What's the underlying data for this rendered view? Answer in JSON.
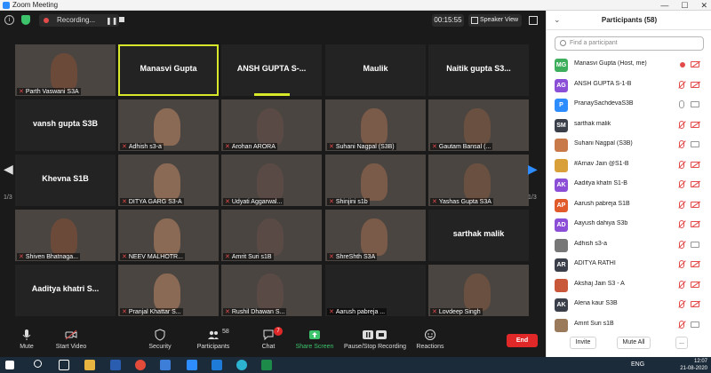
{
  "window": {
    "title": "Zoom Meeting",
    "minimize": "—",
    "maximize": "☐",
    "close": "✕"
  },
  "topbar": {
    "recording_label": "Recording...",
    "pause_symbol": "❚❚",
    "timer": "00:15:55",
    "speaker_view_label": "Speaker View",
    "info_symbol": "i"
  },
  "nav": {
    "left_arrow": "◀",
    "right_arrow": "▶",
    "page_left": "1/3",
    "page_right": "1/3"
  },
  "tiles": [
    {
      "name": "Parth Vaswani S3A",
      "video": true,
      "display": ""
    },
    {
      "name": "Manasvi Gupta",
      "video": false,
      "display": "Manasvi Gupta",
      "active": true
    },
    {
      "name": "ANSH GUPTA S-1-B",
      "video": false,
      "display": "ANSH GUPTA S-...",
      "talking": true
    },
    {
      "name": "Maulik",
      "video": false,
      "display": "Maulik"
    },
    {
      "name": "Naitik gupta S3B",
      "video": false,
      "display": "Naitik  gupta S3..."
    },
    {
      "name": "vansh gupta S3B",
      "video": false,
      "display": "vansh  gupta S3B"
    },
    {
      "name": "Adhish s3-a",
      "video": true,
      "display": ""
    },
    {
      "name": "Arohan ARORA",
      "video": true,
      "display": ""
    },
    {
      "name": "Suhani Nagpal (S3B)",
      "video": true,
      "display": ""
    },
    {
      "name": "Gautam Bansal (...",
      "video": true,
      "display": ""
    },
    {
      "name": "Khevna S1B",
      "video": false,
      "display": "Khevna S1B"
    },
    {
      "name": "DITYA GARG S3-A",
      "video": true,
      "display": ""
    },
    {
      "name": "Udyati Aggarwal...",
      "video": true,
      "display": ""
    },
    {
      "name": "Shinjini s1b",
      "video": true,
      "display": ""
    },
    {
      "name": "Yashas Gupta S3A",
      "video": true,
      "display": ""
    },
    {
      "name": "Shiven Bhatnaga...",
      "video": true,
      "display": ""
    },
    {
      "name": "NEEV MALHOTR...",
      "video": true,
      "display": ""
    },
    {
      "name": "Amrit Suri s1B",
      "video": true,
      "display": ""
    },
    {
      "name": "ShreShth S3A",
      "video": true,
      "display": ""
    },
    {
      "name": "sarthak malik",
      "video": false,
      "display": "sarthak malik"
    },
    {
      "name": "Aaditya khatri S...",
      "video": false,
      "display": "Aaditya  khatri  S..."
    },
    {
      "name": "Pranjal Khattar S...",
      "video": true,
      "display": ""
    },
    {
      "name": "Rushil Dhawan S...",
      "video": true,
      "display": ""
    },
    {
      "name": "Aarush pabreja ...",
      "video": false,
      "display": ""
    },
    {
      "name": "Lovdeep Singh",
      "video": true,
      "display": ""
    }
  ],
  "toolbar": {
    "mute": "Mute",
    "start_video": "Start Video",
    "security": "Security",
    "participants": "Participants",
    "participants_count": "58",
    "chat": "Chat",
    "chat_badge": "7",
    "share_screen": "Share Screen",
    "pause_stop_recording": "Pause/Stop Recording",
    "reactions": "Reactions",
    "end": "End"
  },
  "panel": {
    "title": "Participants (58)",
    "search_placeholder": "Find a participant",
    "invite": "Invite",
    "mute_all": "Mute All",
    "more": "...",
    "participants": [
      {
        "initials": "MG",
        "color": "#3dae5c",
        "name": "Manasvi Gupta (Host, me)",
        "mic": "rec",
        "cam": "off"
      },
      {
        "initials": "AG",
        "color": "#8a4fd6",
        "name": "ANSH GUPTA S-1-B",
        "mic": "off",
        "cam": "off"
      },
      {
        "initials": "P",
        "color": "#2d8cff",
        "name": "PranaySachdevaS3B",
        "mic": "on",
        "cam": "on"
      },
      {
        "initials": "SM",
        "color": "#3a3f4a",
        "name": "sarthak malik",
        "mic": "off",
        "cam": "off"
      },
      {
        "initials": "",
        "color": "#c97a4a",
        "name": "Suhani Nagpal (S3B)",
        "mic": "off",
        "cam": "on"
      },
      {
        "initials": "",
        "color": "#d9a03a",
        "name": "#Arnav Jain @S1-B",
        "mic": "off",
        "cam": "off"
      },
      {
        "initials": "AK",
        "color": "#8a4fd6",
        "name": "Aaditya khatri S1-B",
        "mic": "off",
        "cam": "off"
      },
      {
        "initials": "AP",
        "color": "#e05a2a",
        "name": "Aarush pabreja S1B",
        "mic": "off",
        "cam": "off"
      },
      {
        "initials": "AD",
        "color": "#8a4fd6",
        "name": "Aayush dahiya S3b",
        "mic": "off",
        "cam": "off"
      },
      {
        "initials": "",
        "color": "#777777",
        "name": "Adhish s3-a",
        "mic": "off",
        "cam": "on"
      },
      {
        "initials": "AR",
        "color": "#3a3f4a",
        "name": "ADITYA RATHI",
        "mic": "off",
        "cam": "off"
      },
      {
        "initials": "",
        "color": "#c9583a",
        "name": "Akshaj Jain S3 - A",
        "mic": "off",
        "cam": "off"
      },
      {
        "initials": "AK",
        "color": "#3a3f4a",
        "name": "Alena kaur S3B",
        "mic": "off",
        "cam": "off"
      },
      {
        "initials": "",
        "color": "#9a7a5a",
        "name": "Amrit Suri s1B",
        "mic": "off",
        "cam": "on"
      }
    ]
  },
  "taskbar": {
    "language": "ENG",
    "time": "12:07",
    "date": "21-08-2020"
  }
}
